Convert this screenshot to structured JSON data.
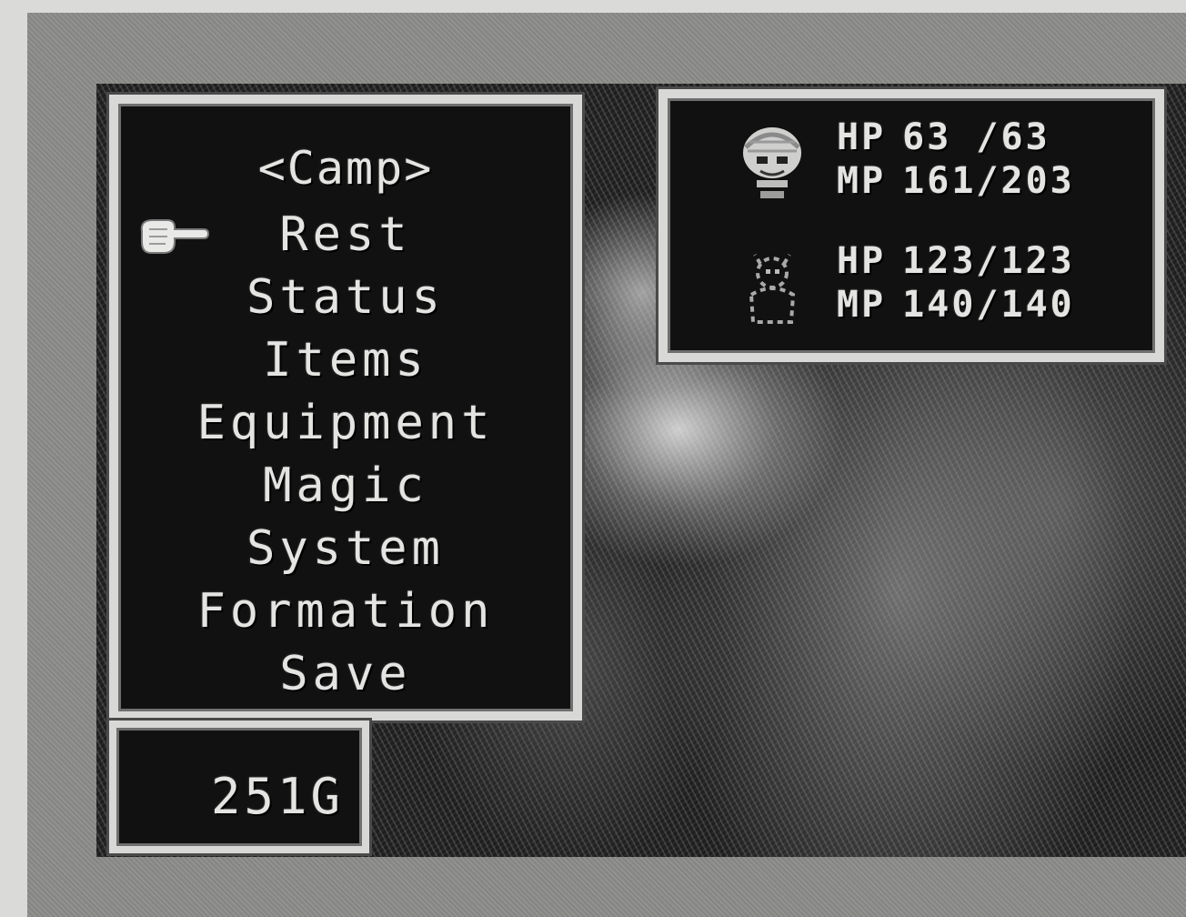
{
  "command_menu": {
    "title": "<Camp>",
    "items": [
      "Rest",
      "Status",
      "Items",
      "Equipment",
      "Magic",
      "System",
      "Formation",
      "Save"
    ],
    "selected_index": 0,
    "cursor_icon": "pointing-hand-icon"
  },
  "party": [
    {
      "portrait_icon": "character-1-portrait-icon",
      "hp_label": "HP",
      "hp_value": "63 /63",
      "mp_label": "MP",
      "mp_value": "161/203"
    },
    {
      "portrait_icon": "character-2-portrait-icon",
      "hp_label": "HP",
      "hp_value": "123/123",
      "mp_label": "MP",
      "mp_value": "140/140"
    }
  ],
  "gold": {
    "value": "251G"
  },
  "colors": {
    "window_bg": "#111111",
    "window_border": "#d8d8d6",
    "text": "#e4e4e2"
  }
}
